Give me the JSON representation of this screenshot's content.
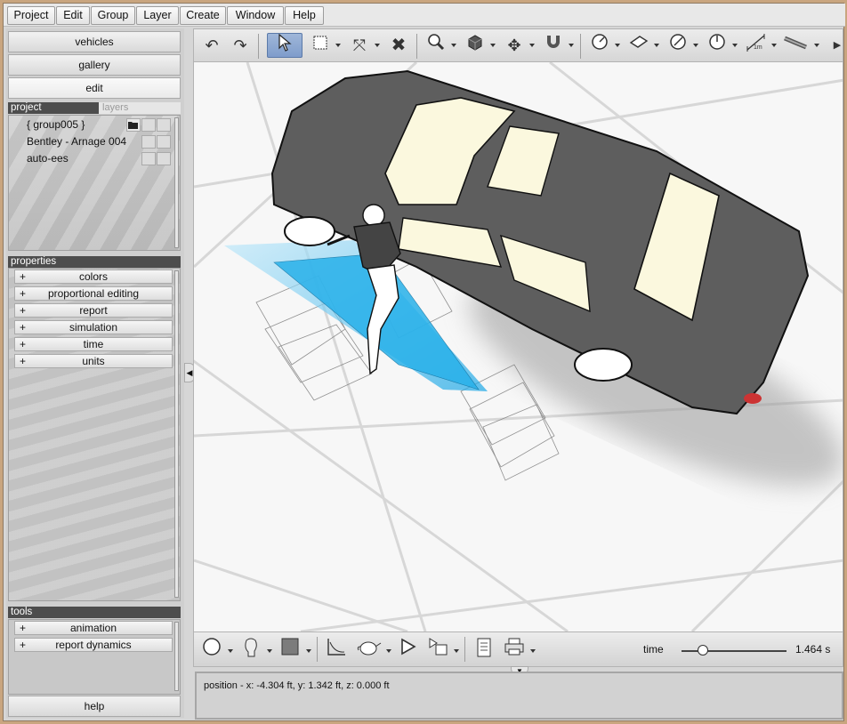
{
  "menu": [
    "Project",
    "Edit",
    "Group",
    "Layer",
    "Create",
    "Window",
    "Help"
  ],
  "nav": {
    "vehicles": "vehicles",
    "gallery": "gallery",
    "edit": "edit",
    "help": "help"
  },
  "project_panel": {
    "tab_project": "project",
    "tab_layers": "layers",
    "items": [
      "{ group005 }",
      "Bentley - Arnage 004",
      "auto-ees"
    ]
  },
  "properties": {
    "header": "properties",
    "sections": [
      "colors",
      "proportional editing",
      "report",
      "simulation",
      "time",
      "units"
    ]
  },
  "tools": {
    "header": "tools",
    "sections": [
      "animation",
      "report dynamics"
    ]
  },
  "toolbar_icons": [
    "undo-icon",
    "redo-icon",
    "select-arrow-icon",
    "rectangle-select-icon",
    "transform-icon",
    "delete-icon",
    "zoom-icon",
    "box-icon",
    "move-icon",
    "magnet-icon",
    "measure-circle-icon",
    "plane-icon",
    "angle-icon",
    "rotate-icon",
    "ruler-1m-icon",
    "tape-icon"
  ],
  "ruler_label": "1m",
  "timeline": {
    "label": "time",
    "value": "1.464 s",
    "position_fraction": 0.2
  },
  "status": {
    "position": "position - x: -4.304 ft, y: 1.342 ft, z: 0.000 ft"
  },
  "colors": {
    "selected_tool": "#7f9ccb",
    "car_body": "#5e5e5e",
    "windows": "#fbf8de",
    "sweep_cyan": "#25b4ea"
  }
}
